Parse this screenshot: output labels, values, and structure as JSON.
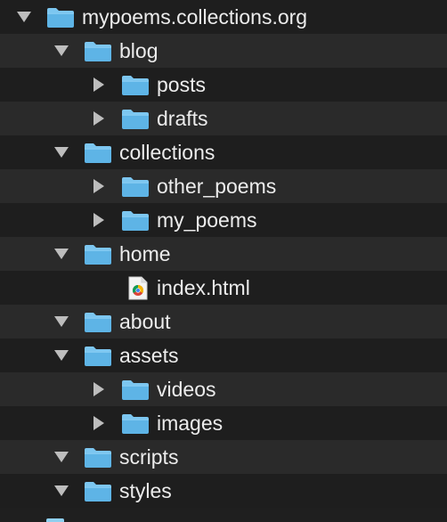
{
  "tree": {
    "rows": [
      {
        "label": "mypoems.collections.org",
        "depth": 0,
        "type": "folder",
        "expanded": true
      },
      {
        "label": "blog",
        "depth": 1,
        "type": "folder",
        "expanded": true
      },
      {
        "label": "posts",
        "depth": 2,
        "type": "folder",
        "expanded": false
      },
      {
        "label": "drafts",
        "depth": 2,
        "type": "folder",
        "expanded": false
      },
      {
        "label": "collections",
        "depth": 1,
        "type": "folder",
        "expanded": true
      },
      {
        "label": "other_poems",
        "depth": 2,
        "type": "folder",
        "expanded": false
      },
      {
        "label": "my_poems",
        "depth": 2,
        "type": "folder",
        "expanded": false
      },
      {
        "label": "home",
        "depth": 1,
        "type": "folder",
        "expanded": true
      },
      {
        "label": "index.html",
        "depth": 2,
        "type": "file",
        "icon": "chrome-html-file-icon"
      },
      {
        "label": "about",
        "depth": 1,
        "type": "folder",
        "expanded": true
      },
      {
        "label": "assets",
        "depth": 1,
        "type": "folder",
        "expanded": true
      },
      {
        "label": "videos",
        "depth": 2,
        "type": "folder",
        "expanded": false
      },
      {
        "label": "images",
        "depth": 2,
        "type": "folder",
        "expanded": false
      },
      {
        "label": "scripts",
        "depth": 1,
        "type": "folder",
        "expanded": true
      },
      {
        "label": "styles",
        "depth": 1,
        "type": "folder",
        "expanded": true
      }
    ]
  },
  "colors": {
    "background_even": "#1e1e1e",
    "background_odd": "#2a2a2a",
    "text": "#ececec",
    "disclosure": "#bdbdbd",
    "folder_body": "#5eb4e6",
    "folder_tab": "#7cc6f0"
  }
}
